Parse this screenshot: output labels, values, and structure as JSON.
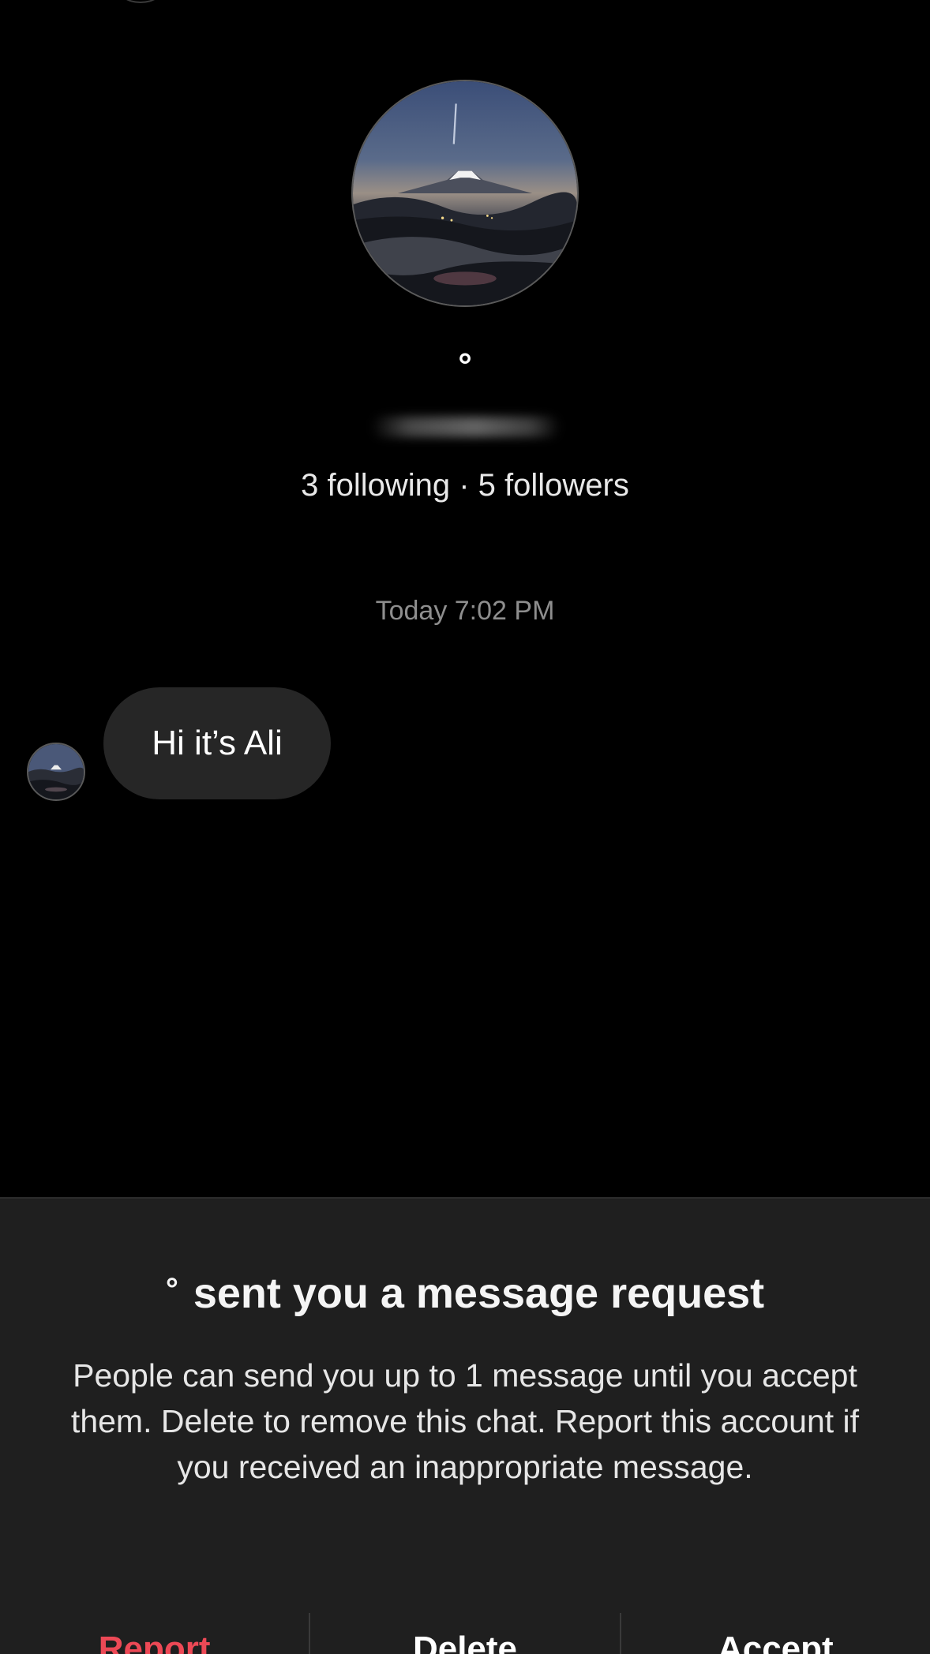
{
  "profile": {
    "name_glyph": "°",
    "follow_stats": "3 following · 5 followers"
  },
  "conversation": {
    "timestamp": "Today 7:02 PM",
    "messages": [
      {
        "text": "Hi it’s Ali"
      }
    ]
  },
  "request": {
    "sender_glyph": "°",
    "title": "sent you a message request",
    "description": "People can send you up to 1 message until you accept them. Delete to remove this chat. Report this account if you received an inappropriate message.",
    "actions": {
      "report": "Report",
      "delete": "Delete",
      "accept": "Accept"
    }
  },
  "colors": {
    "background": "#000000",
    "bubble": "#262626",
    "panel": "#1f1f1f",
    "report": "#ed4956",
    "muted_text": "#8e8e8e"
  }
}
